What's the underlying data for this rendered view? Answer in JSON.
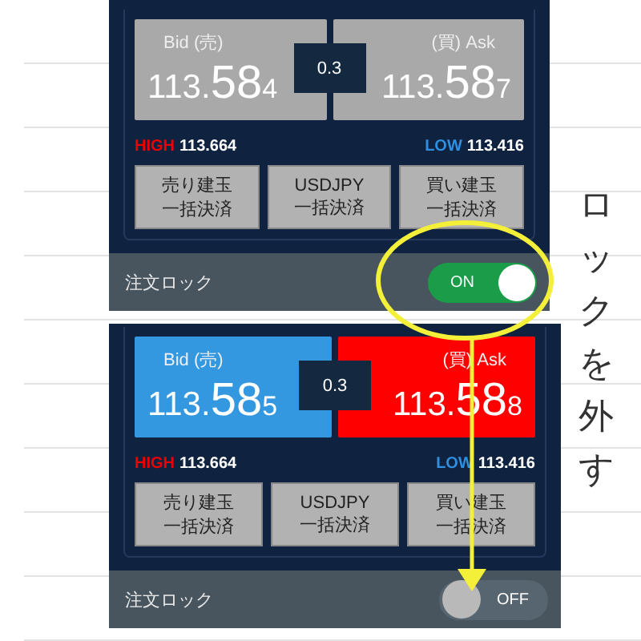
{
  "panels": [
    {
      "quotes_active": false,
      "bid": {
        "label": "Bid (売)",
        "prefix": "113.",
        "main": "58",
        "suffix": "4"
      },
      "spread": "0.3",
      "ask": {
        "label": "(買) Ask",
        "prefix": "113.",
        "main": "58",
        "suffix": "7"
      },
      "high": {
        "label": "HIGH",
        "value": "113.664"
      },
      "low": {
        "label": "LOW",
        "value": "113.416"
      },
      "buttons": [
        [
          "売り建玉",
          "一括決済"
        ],
        [
          "USDJPY",
          "一括決済"
        ],
        [
          "買い建玉",
          "一括決済"
        ]
      ],
      "lock_label": "注文ロック",
      "toggle": {
        "on": true,
        "label": "ON"
      }
    },
    {
      "quotes_active": true,
      "bid": {
        "label": "Bid (売)",
        "prefix": "113.",
        "main": "58",
        "suffix": "5"
      },
      "spread": "0.3",
      "ask": {
        "label": "(買) Ask",
        "prefix": "113.",
        "main": "58",
        "suffix": "8"
      },
      "high": {
        "label": "HIGH",
        "value": "113.664"
      },
      "low": {
        "label": "LOW",
        "value": "113.416"
      },
      "buttons": [
        [
          "売り建玉",
          "一括決済"
        ],
        [
          "USDJPY",
          "一括決済"
        ],
        [
          "買い建玉",
          "一括決済"
        ]
      ],
      "lock_label": "注文ロック",
      "toggle": {
        "on": false,
        "label": "OFF"
      }
    }
  ],
  "annotation": {
    "text": "ロックを外す"
  }
}
